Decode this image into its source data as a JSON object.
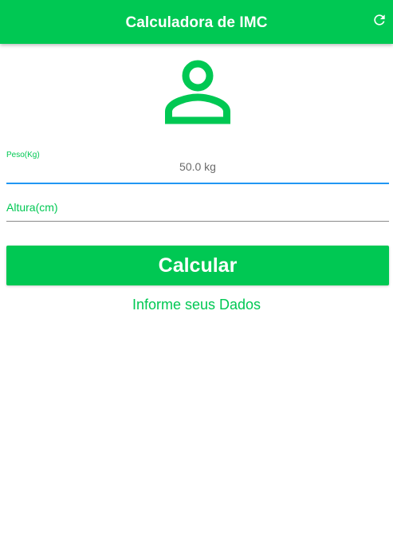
{
  "appbar": {
    "title": "Calculadora de IMC",
    "refresh_icon": "refresh-icon"
  },
  "avatar": {
    "icon": "person-outline-icon"
  },
  "form": {
    "peso": {
      "label": "Peso(Kg)",
      "value": "50.0 kg"
    },
    "altura": {
      "label": "Altura(cm)",
      "value": ""
    }
  },
  "calcular_button": {
    "label": "Calcular"
  },
  "info_text": "Informe seus Dados",
  "colors": {
    "primary": "#00c853",
    "focus_underline": "#2196f3"
  }
}
